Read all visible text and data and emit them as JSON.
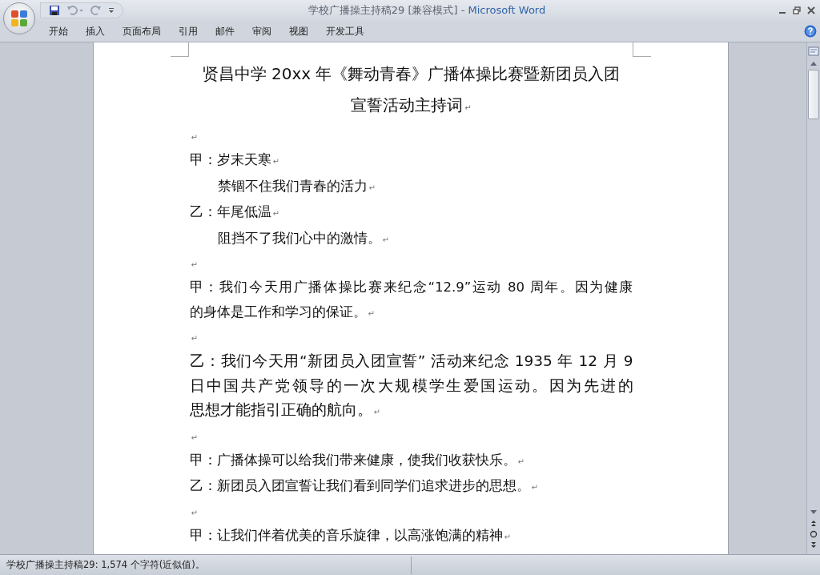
{
  "window": {
    "document_name": "学校广播操主持稿29 [兼容模式]",
    "app_separator": " - ",
    "app_name": "Microsoft Word"
  },
  "ribbon_tabs": [
    {
      "label": "开始"
    },
    {
      "label": "插入"
    },
    {
      "label": "页面布局"
    },
    {
      "label": "引用"
    },
    {
      "label": "邮件"
    },
    {
      "label": "审阅"
    },
    {
      "label": "视图"
    },
    {
      "label": "开发工具"
    }
  ],
  "paragraphs": [
    {
      "kind": "title",
      "lines": [
        "贤昌中学 20xx 年《舞动青春》广播体操比赛暨新团员入团",
        "宣誓活动主持词"
      ],
      "end_mark": "↵"
    },
    {
      "kind": "blank",
      "end_mark": "↵"
    },
    {
      "kind": "speech",
      "lines": [
        "甲：岁末天寒"
      ],
      "end_mark": "↵"
    },
    {
      "kind": "indent",
      "lines": [
        "禁锢不住我们青春的活力"
      ],
      "end_mark": "↵"
    },
    {
      "kind": "speech",
      "lines": [
        "乙：年尾低温"
      ],
      "end_mark": "↵"
    },
    {
      "kind": "indent",
      "lines": [
        "阻挡不了我们心中的激情。"
      ],
      "end_mark": "↵"
    },
    {
      "kind": "blank",
      "end_mark": "↵"
    },
    {
      "kind": "speech",
      "lines": [
        "甲：我们今天用广播体操比赛来纪念“12.9”运动 80 周年。因为健康",
        "的身体是工作和学习的保证。"
      ],
      "end_mark": "↵"
    },
    {
      "kind": "blank",
      "end_mark": "↵"
    },
    {
      "kind": "large",
      "lines": [
        "乙：我们今天用“新团员入团宣誓” 活动来纪念 1935 年 12 月 9",
        "日中国共产党领导的一次大规模学生爱国运动。因为先进的",
        "思想才能指引正确的航向。"
      ],
      "end_mark": "↵"
    },
    {
      "kind": "blank",
      "end_mark": "↵"
    },
    {
      "kind": "speech",
      "lines": [
        "甲：广播体操可以给我们带来健康，使我们收获快乐。"
      ],
      "end_mark": "↵"
    },
    {
      "kind": "speech",
      "lines": [
        "乙：新团员入团宣誓让我们看到同学们追求进步的思想。"
      ],
      "end_mark": "↵"
    },
    {
      "kind": "blank",
      "end_mark": "↵"
    },
    {
      "kind": "speech",
      "lines": [
        "甲：让我们伴着优美的音乐旋律，以高涨饱满的精神"
      ],
      "end_mark": "↵"
    }
  ],
  "status_bar": {
    "text": "学校广播操主持稿29: 1,574 个字符(近似值)。"
  }
}
